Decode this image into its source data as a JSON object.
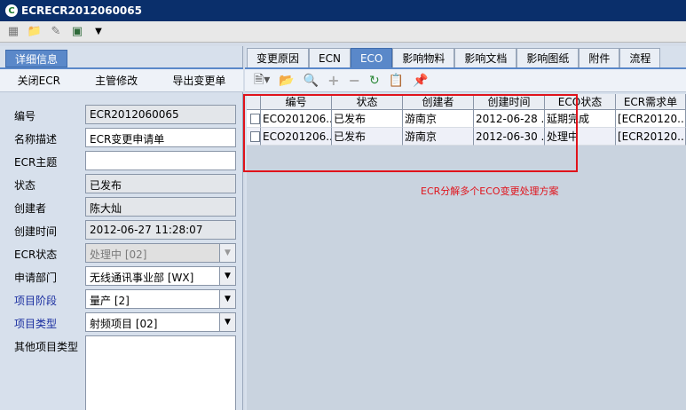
{
  "window": {
    "title": "ECRECR2012060065",
    "icon": "C"
  },
  "toolbar": {
    "icons": [
      "save-icon",
      "folder-icon",
      "pencil-icon",
      "export-icon",
      "dropdown-icon"
    ]
  },
  "left": {
    "tab_label": "详细信息",
    "actions": [
      "关闭ECR",
      "主管修改",
      "导出变更单"
    ],
    "fields": [
      {
        "label": "编号",
        "value": "ECR2012060065",
        "type": "readonly"
      },
      {
        "label": "名称描述",
        "value": "ECR变更申请单",
        "type": "input"
      },
      {
        "label": "ECR主题",
        "value": "",
        "type": "input"
      },
      {
        "label": "状态",
        "value": "已发布",
        "type": "readonly"
      },
      {
        "label": "创建者",
        "value": "陈大灿",
        "type": "readonly"
      },
      {
        "label": "创建时间",
        "value": "2012-06-27 11:28:07",
        "type": "readonly"
      },
      {
        "label": "ECR状态",
        "value": "处理中 [02]",
        "type": "disabled-select"
      },
      {
        "label": "申请部门",
        "value": "无线通讯事业部 [WX]",
        "type": "select"
      },
      {
        "label": "项目阶段",
        "value": "量产 [2]",
        "type": "select",
        "blue": true
      },
      {
        "label": "项目类型",
        "value": "射频项目 [02]",
        "type": "select",
        "blue": true
      },
      {
        "label": "其他项目类型",
        "value": "",
        "type": "textarea"
      }
    ]
  },
  "right": {
    "tabs": [
      "变更原因",
      "ECN",
      "ECO",
      "影响物料",
      "影响文档",
      "影响图纸",
      "附件",
      "流程"
    ],
    "active_tab": 2,
    "grid": {
      "columns": [
        "编号",
        "状态",
        "创建者",
        "创建时间",
        "ECO状态",
        "ECR需求单"
      ],
      "rows": [
        [
          "ECO201206...",
          "已发布",
          "游南京",
          "2012-06-28 ...",
          "延期完成",
          "[ECR20120..."
        ],
        [
          "ECO201206...",
          "已发布",
          "游南京",
          "2012-06-30 ...",
          "处理中",
          "[ECR20120..."
        ]
      ]
    }
  },
  "annotation": {
    "text": "ECR分解多个ECO变更处理方案",
    "color": "#e0131b"
  }
}
